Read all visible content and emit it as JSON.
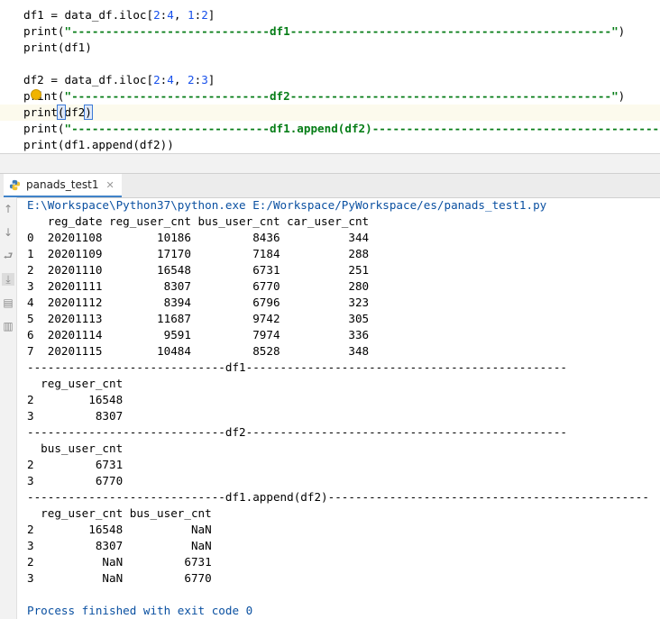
{
  "editor": {
    "lines": [
      {
        "id": "line1",
        "parts": [
          {
            "t": "df1 = data_df.iloc[",
            "c": ""
          },
          {
            "t": "2",
            "c": "num"
          },
          {
            "t": ":",
            "c": ""
          },
          {
            "t": "4",
            "c": "num"
          },
          {
            "t": ", ",
            "c": ""
          },
          {
            "t": "1",
            "c": "num"
          },
          {
            "t": ":",
            "c": ""
          },
          {
            "t": "2",
            "c": "num"
          },
          {
            "t": "]",
            "c": ""
          }
        ]
      },
      {
        "id": "line2",
        "parts": [
          {
            "t": "print(",
            "c": ""
          },
          {
            "t": "\"-----------------------------df1-----------------------------------------------\"",
            "c": "str"
          },
          {
            "t": ")",
            "c": ""
          }
        ]
      },
      {
        "id": "line3",
        "parts": [
          {
            "t": "print(df1)",
            "c": ""
          }
        ]
      },
      {
        "id": "line5",
        "parts": [
          {
            "t": "df2 = data_df.iloc[",
            "c": ""
          },
          {
            "t": "2",
            "c": "num"
          },
          {
            "t": ":",
            "c": ""
          },
          {
            "t": "4",
            "c": "num"
          },
          {
            "t": ", ",
            "c": ""
          },
          {
            "t": "2",
            "c": "num"
          },
          {
            "t": ":",
            "c": ""
          },
          {
            "t": "3",
            "c": "num"
          },
          {
            "t": "]",
            "c": ""
          }
        ]
      },
      {
        "id": "line6",
        "parts": [
          {
            "t": "print(",
            "c": ""
          },
          {
            "t": "\"-----------------------------df2-----------------------------------------------\"",
            "c": "str"
          },
          {
            "t": ")",
            "c": ""
          }
        ]
      },
      {
        "id": "line7",
        "parts": [
          {
            "t": "print(df2)",
            "c": ""
          }
        ]
      },
      {
        "id": "line8",
        "parts": [
          {
            "t": "print(",
            "c": ""
          },
          {
            "t": "\"-----------------------------df1.append(df2)-----------------------------------------------",
            "c": "str"
          }
        ]
      },
      {
        "id": "line9",
        "parts": [
          {
            "t": "print(df1.append(df2))",
            "c": ""
          }
        ]
      }
    ]
  },
  "run_panel": {
    "tab_label": "panads_test1",
    "command": "E:\\Workspace\\Python37\\python.exe E:/Workspace/PyWorkspace/es/panads_test1.py",
    "output_lines": [
      "   reg_date reg_user_cnt bus_user_cnt car_user_cnt",
      "0  20201108        10186         8436          344",
      "1  20201109        17170         7184          288",
      "2  20201110        16548         6731          251",
      "3  20201111         8307         6770          280",
      "4  20201112         8394         6796          323",
      "5  20201113        11687         9742          305",
      "6  20201114         9591         7974          336",
      "7  20201115        10484         8528          348",
      "-----------------------------df1-----------------------------------------------",
      "  reg_user_cnt",
      "2        16548",
      "3         8307",
      "-----------------------------df2-----------------------------------------------",
      "  bus_user_cnt",
      "2         6731",
      "3         6770",
      "-----------------------------df1.append(df2)-----------------------------------------------",
      "  reg_user_cnt bus_user_cnt",
      "2        16548          NaN",
      "3         8307          NaN",
      "2          NaN         6731",
      "3          NaN         6770",
      "",
      "Process finished with exit code 0"
    ]
  }
}
